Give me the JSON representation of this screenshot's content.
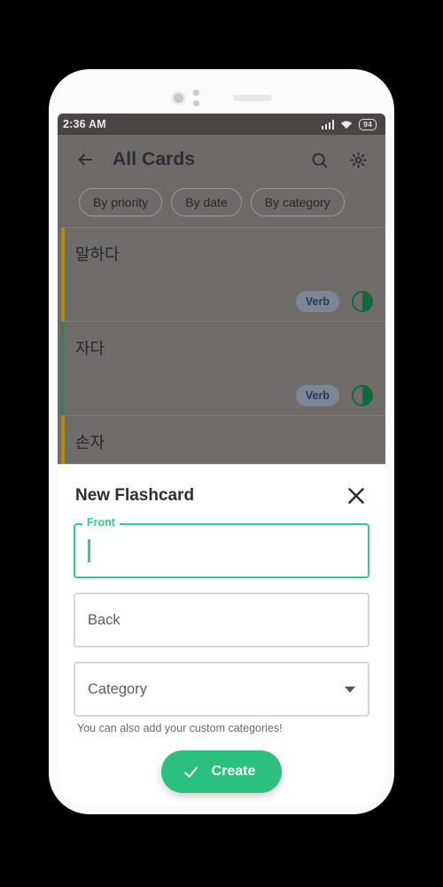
{
  "status_bar": {
    "time": "2:36 AM",
    "battery": "94",
    "signal_icon": "cellular-signal-icon",
    "wifi_icon": "wifi-icon"
  },
  "app_bar": {
    "title": "All Cards",
    "back_icon": "back-arrow-icon",
    "search_icon": "search-icon",
    "settings_icon": "gear-icon"
  },
  "filters": [
    {
      "label": "By priority"
    },
    {
      "label": "By date"
    },
    {
      "label": "By category"
    }
  ],
  "cards": [
    {
      "title": "말하다",
      "badge": "Verb",
      "accent": "#b8860b",
      "progress_icon": "half-filled-circle-icon"
    },
    {
      "title": "자다",
      "badge": "Verb",
      "accent": "#3d7a5e",
      "progress_icon": "half-filled-circle-icon"
    },
    {
      "title": "손자",
      "badge": "",
      "accent": "#b8860b",
      "progress_icon": ""
    }
  ],
  "sheet": {
    "title": "New Flashcard",
    "close_icon": "close-icon",
    "front": {
      "legend": "Front",
      "value": "",
      "placeholder": ""
    },
    "back": {
      "placeholder": "Back",
      "value": ""
    },
    "category": {
      "placeholder": "Category",
      "value": "",
      "chevron_icon": "chevron-down-icon"
    },
    "helper_text": "You can also add your custom categories!",
    "create": {
      "label": "Create",
      "icon": "check-icon"
    }
  },
  "theme": {
    "accent_green": "#2ecc8f",
    "button_green": "#2bc17d",
    "scrim": "rgba(0,0,0,0.45)"
  }
}
